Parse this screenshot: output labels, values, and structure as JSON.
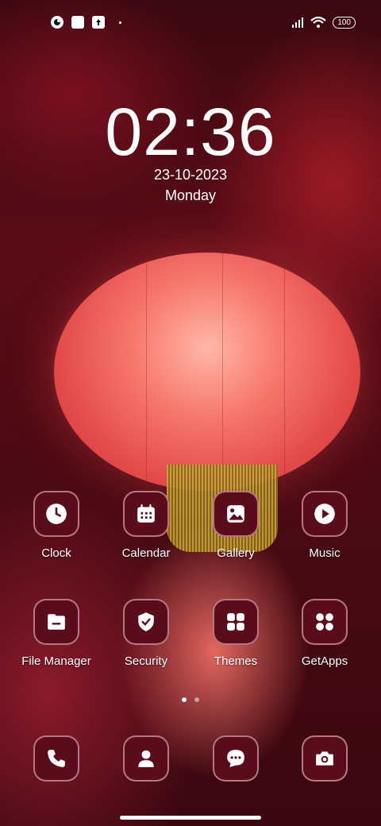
{
  "status_bar": {
    "left_icons": [
      "app-icon-1",
      "square-icon",
      "upload-icon"
    ],
    "battery": "100"
  },
  "lockclock": {
    "time": "02:36",
    "date": "23-10-2023",
    "day": "Monday"
  },
  "apps": [
    {
      "label": "Clock",
      "icon": "clock-icon"
    },
    {
      "label": "Calendar",
      "icon": "calendar-icon"
    },
    {
      "label": "Gallery",
      "icon": "image-icon"
    },
    {
      "label": "Music",
      "icon": "play-icon"
    },
    {
      "label": "File Manager",
      "icon": "folder-icon"
    },
    {
      "label": "Security",
      "icon": "shield-icon"
    },
    {
      "label": "Themes",
      "icon": "grid-icon"
    },
    {
      "label": "GetApps",
      "icon": "apps-icon"
    }
  ],
  "dock": [
    {
      "icon": "phone-icon"
    },
    {
      "icon": "contacts-icon"
    },
    {
      "icon": "messages-icon"
    },
    {
      "icon": "camera-icon"
    }
  ],
  "page_indicator": {
    "count": 2,
    "active": 0
  },
  "colors": {
    "icon_bg": "#5b0c1c"
  }
}
